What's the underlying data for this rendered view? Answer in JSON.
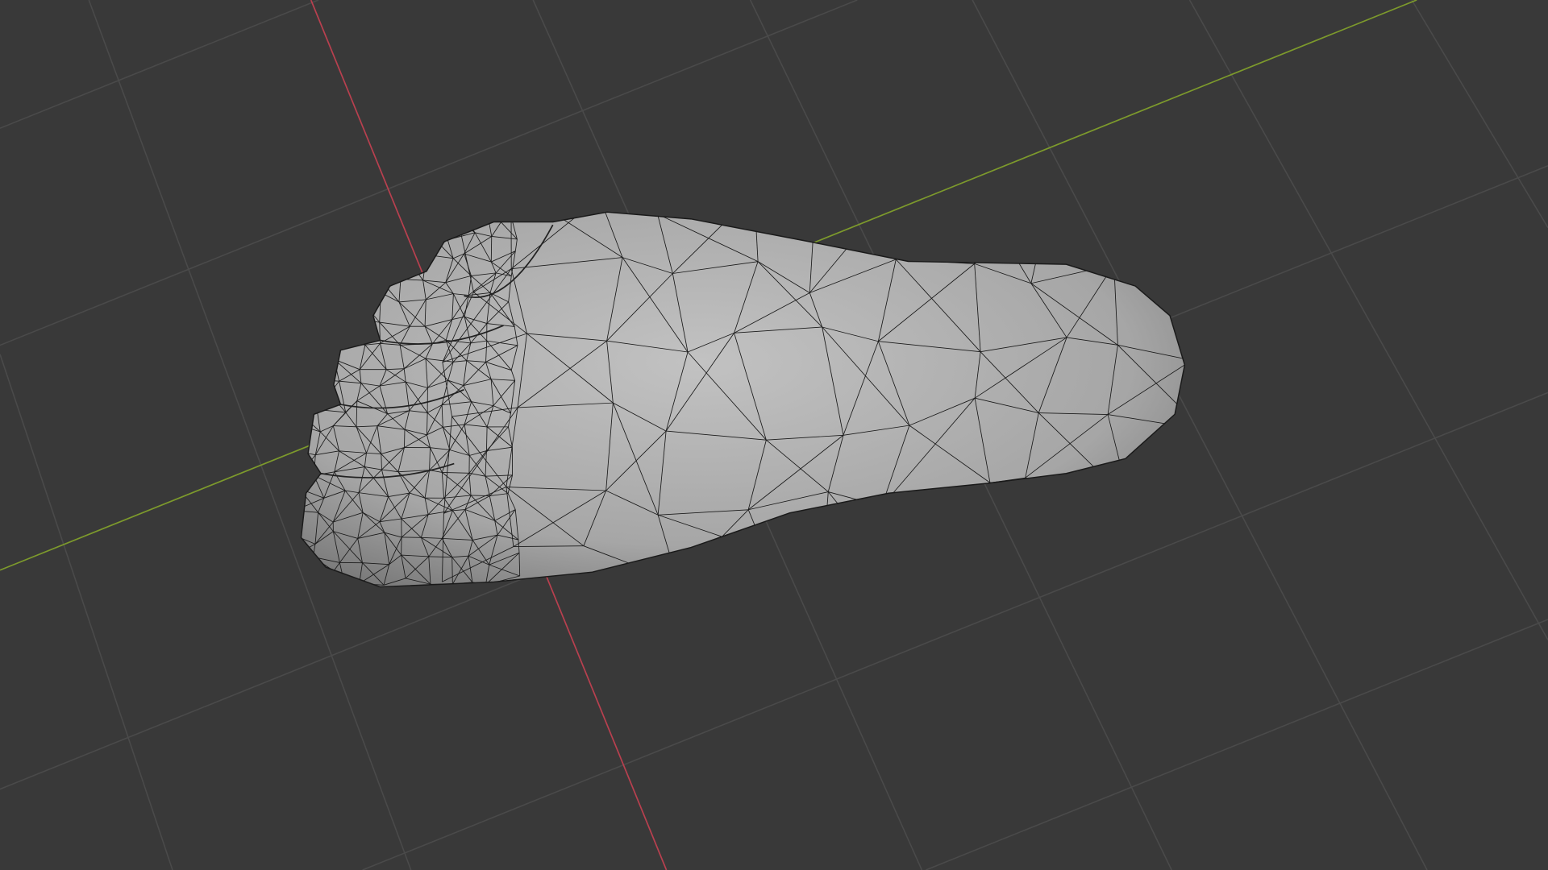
{
  "viewport": {
    "mode": "3d-viewport",
    "object": "foot-mesh",
    "shading": "solid-wireframe",
    "colors": {
      "background": "#393939",
      "grid": "#4a4a4a",
      "x_axis": "#b8404f",
      "y_axis": "#7d9a2c",
      "mesh": "#a9a9a9",
      "wire": "#1a1a1a"
    }
  }
}
